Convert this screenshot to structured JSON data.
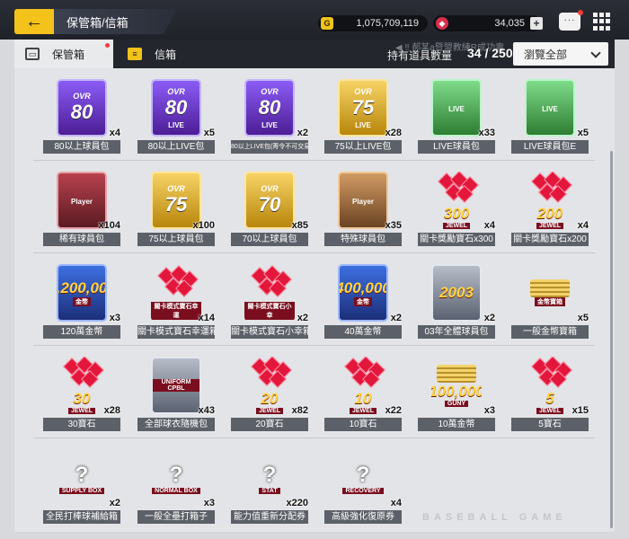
{
  "header": {
    "back_icon": "←",
    "title": "保管箱/信箱",
    "gold_icon": "G",
    "gold": "1,075,709,119",
    "gem_icon": "◆",
    "gems": "34,035",
    "gem_plus": "+",
    "chat_icon": "···"
  },
  "tabs": {
    "storage_icon": "▭",
    "storage": "保管箱",
    "mail_icon": "≡",
    "mail": "信箱"
  },
  "notice": "◀ ‼ 郝某a暨盟教練R成功壽",
  "hold": {
    "label": "持有道具數量",
    "count": "34 / 250"
  },
  "filter": {
    "selected": "瀏覽全部"
  },
  "watermark": "BASEBALL GAME",
  "items": [
    {
      "label": "80以上球員包",
      "count": "x4",
      "ovr": "OVR",
      "big": "80",
      "tag": ""
    },
    {
      "label": "80以上LIVE包",
      "count": "x5",
      "ovr": "OVR",
      "big": "80",
      "tag": "LIVE"
    },
    {
      "label": "80以上LIVE包(寄令不可交易)",
      "count": "x2",
      "ovr": "OVR",
      "big": "80",
      "tag": "LIVE"
    },
    {
      "label": "75以上LIVE包",
      "count": "x28",
      "ovr": "OVR",
      "big": "75",
      "tag": "LIVE"
    },
    {
      "label": "LIVE球員包",
      "count": "x33",
      "tag": "LIVE"
    },
    {
      "label": "LIVE球員包E",
      "count": "x5",
      "tag": "LIVE"
    },
    {
      "label": "稀有球員包",
      "count": "x104",
      "tag": "Player"
    },
    {
      "label": "75以上球員包",
      "count": "x100",
      "ovr": "OVR",
      "big": "75"
    },
    {
      "label": "70以上球員包",
      "count": "x85",
      "ovr": "OVR",
      "big": "70"
    },
    {
      "label": "特殊球員包",
      "count": "x35",
      "tag": "Player"
    },
    {
      "label": "關卡獎勵寶石x300",
      "count": "x4",
      "num": "300",
      "jewel": "JEWEL"
    },
    {
      "label": "關卡獎勵寶石x200",
      "count": "x4",
      "num": "200",
      "jewel": "JEWEL"
    },
    {
      "label": "120萬金幣",
      "count": "x3",
      "num": "1,200,000",
      "jewel": "金幣"
    },
    {
      "label": "關卡模式寶石幸運箱",
      "count": "x14",
      "jewel": "關卡模式寶石幸運"
    },
    {
      "label": "關卡模式寶石小幸箱",
      "count": "x2",
      "jewel": "關卡模式寶石小幸"
    },
    {
      "label": "40萬金幣",
      "count": "x2",
      "num": "400,000",
      "jewel": "金幣"
    },
    {
      "label": "03年全體球員包",
      "count": "x2",
      "num": "2003"
    },
    {
      "label": "一般金幣寶箱",
      "count": "x5",
      "jewel": "金幣寶箱"
    },
    {
      "label": "30寶石",
      "count": "x28",
      "num": "30",
      "jewel": "JEWEL"
    },
    {
      "label": "全部球衣隨機包",
      "count": "x43",
      "jewel": "UNIFORM CPBL"
    },
    {
      "label": "20寶石",
      "count": "x82",
      "num": "20",
      "jewel": "JEWEL"
    },
    {
      "label": "10寶石",
      "count": "x22",
      "num": "10",
      "jewel": "JEWEL"
    },
    {
      "label": "10萬金幣",
      "count": "x3",
      "num": "100,000",
      "jewel": "GUNY"
    },
    {
      "label": "5寶石",
      "count": "x15",
      "num": "5",
      "jewel": "JEWEL"
    },
    {
      "label": "全民打棒球補給箱",
      "count": "x2",
      "jewel": "SUPPLY BOX"
    },
    {
      "label": "一般全壘打箱子",
      "count": "x3",
      "jewel": "NORMAL BOX"
    },
    {
      "label": "能力值重新分配券",
      "count": "x220",
      "jewel": "STAT"
    },
    {
      "label": "高級強化復原券",
      "count": "x4",
      "jewel": "RECOVERY"
    }
  ]
}
